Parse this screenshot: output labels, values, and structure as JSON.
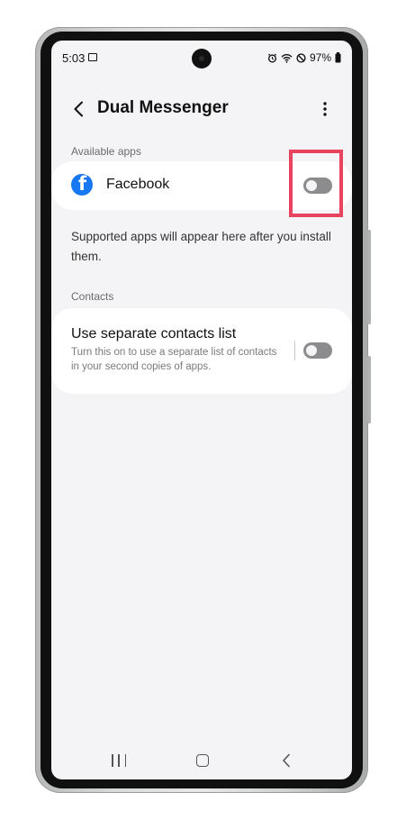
{
  "status_bar": {
    "time": "5:03",
    "battery": "97%"
  },
  "app_bar": {
    "title": "Dual Messenger"
  },
  "available_apps": {
    "section_label": "Available apps",
    "items": [
      {
        "label": "Facebook",
        "enabled": false
      }
    ],
    "info_text": "Supported apps will appear here after you install them."
  },
  "contacts": {
    "section_label": "Contacts",
    "title": "Use separate contacts list",
    "description": "Turn this on to use a separate list of contacts in your second copies of apps.",
    "enabled": false
  },
  "colors": {
    "highlight": "#e8435f",
    "facebook_blue": "#1877f2",
    "toggle_off": "#8c8c8f",
    "screen_bg": "#f4f4f6"
  },
  "icons": [
    "gallery-icon",
    "alarm-icon",
    "wifi-icon",
    "do-not-disturb-icon",
    "battery-icon",
    "back-arrow-icon",
    "more-vertical-icon",
    "facebook-icon",
    "recents-icon",
    "home-icon",
    "nav-back-icon"
  ]
}
